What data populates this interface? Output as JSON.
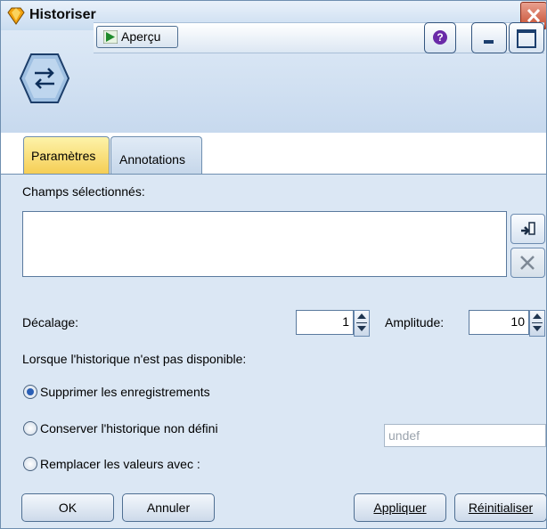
{
  "window": {
    "title": "Historiser"
  },
  "toolbar": {
    "preview_label": "Aperçu"
  },
  "tabs": [
    {
      "label": "Paramètres",
      "active": true
    },
    {
      "label": "Annotations",
      "active": false
    }
  ],
  "settings": {
    "fields_label": "Champs sélectionnés:",
    "offset_label": "Décalage:",
    "offset_value": "1",
    "span_label": "Amplitude:",
    "span_value": "10",
    "history_unavailable_label": "Lorsque l'historique n'est pas disponible:",
    "options": [
      {
        "label": "Supprimer les enregistrements",
        "selected": true
      },
      {
        "label": "Conserver l'historique non défini",
        "selected": false
      },
      {
        "label": "Remplacer les valeurs avec :",
        "selected": false
      }
    ],
    "replace_value": "undef"
  },
  "buttons": {
    "ok": "OK",
    "cancel": "Annuler",
    "apply": "Appliquer",
    "reset": "Réinitialiser"
  },
  "icons": {
    "node": "history-node-icon",
    "pick_fields": "field-picker-icon",
    "delete": "delete-icon",
    "help": "help-icon"
  },
  "colors": {
    "active_tab": "#f5cd53",
    "content_bg": "#dbe7f4",
    "radio_selected": "#2a5fb6"
  }
}
